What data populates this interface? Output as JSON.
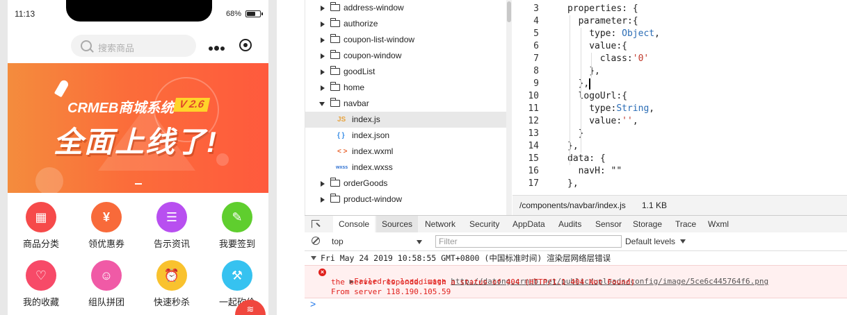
{
  "phone": {
    "time": "11:13",
    "battery_pct": "68%",
    "battery_level": 0.68,
    "search_placeholder": "搜索商品",
    "banner": {
      "brand": "CRMEB商城系统",
      "version": "V 2.6",
      "slogan": "全面上线了!"
    },
    "grid": [
      {
        "label": "商品分类",
        "icon": "category-icon",
        "color": "#f64a4a",
        "glyph": "▦"
      },
      {
        "label": "领优惠券",
        "icon": "coupon-icon",
        "color": "#f86a3a",
        "glyph": "¥"
      },
      {
        "label": "告示资讯",
        "icon": "news-icon",
        "color": "#b84ff0",
        "glyph": "☰"
      },
      {
        "label": "我要签到",
        "icon": "sign-in-icon",
        "color": "#5fce2e",
        "glyph": "✎"
      },
      {
        "label": "我的收藏",
        "icon": "favorite-icon",
        "color": "#f74a68",
        "glyph": "♡"
      },
      {
        "label": "组队拼团",
        "icon": "group-buy-icon",
        "color": "#f05aa6",
        "glyph": "☺"
      },
      {
        "label": "快速秒杀",
        "icon": "flash-sale-icon",
        "color": "#f9c22e",
        "glyph": "⏰"
      },
      {
        "label": "一起砍价",
        "icon": "bargain-icon",
        "color": "#36c2f0",
        "glyph": "⚒"
      }
    ]
  },
  "file_tree": [
    {
      "name": "address-window",
      "type": "folder",
      "expanded": false
    },
    {
      "name": "authorize",
      "type": "folder",
      "expanded": false
    },
    {
      "name": "coupon-list-window",
      "type": "folder",
      "expanded": false
    },
    {
      "name": "coupon-window",
      "type": "folder",
      "expanded": false
    },
    {
      "name": "goodList",
      "type": "folder",
      "expanded": false
    },
    {
      "name": "home",
      "type": "folder",
      "expanded": false
    },
    {
      "name": "navbar",
      "type": "folder",
      "expanded": true
    },
    {
      "name": "index.js",
      "type": "js",
      "icon_text": "JS",
      "selected": true
    },
    {
      "name": "index.json",
      "type": "json",
      "icon_text": "{ }"
    },
    {
      "name": "index.wxml",
      "type": "wxml",
      "icon_text": "< >"
    },
    {
      "name": "index.wxss",
      "type": "wxss",
      "icon_text": "wxss"
    },
    {
      "name": "orderGoods",
      "type": "folder",
      "expanded": false
    },
    {
      "name": "product-window",
      "type": "folder",
      "expanded": false
    }
  ],
  "editor": {
    "lines": [
      {
        "n": "3",
        "indent": 0,
        "text": "properties: {"
      },
      {
        "n": "4",
        "indent": 1,
        "text": "parameter:{"
      },
      {
        "n": "5",
        "indent": 2,
        "text": "type: ",
        "type": "Object",
        "tail": ","
      },
      {
        "n": "6",
        "indent": 2,
        "text": "value:{"
      },
      {
        "n": "7",
        "indent": 3,
        "text": "class:",
        "str": "'0'"
      },
      {
        "n": "8",
        "indent": 2,
        "text": "},"
      },
      {
        "n": "9",
        "indent": 1,
        "text": "},"
      },
      {
        "n": "10",
        "indent": 1,
        "text": "logoUrl:{"
      },
      {
        "n": "11",
        "indent": 2,
        "text": "type:",
        "type": "String",
        "tail": ","
      },
      {
        "n": "12",
        "indent": 2,
        "text": "value:",
        "str": "''",
        "tail": ","
      },
      {
        "n": "13",
        "indent": 1,
        "text": "}"
      },
      {
        "n": "14",
        "indent": 0,
        "text": "},"
      },
      {
        "n": "15",
        "indent": 0,
        "text": "data: {"
      },
      {
        "n": "16",
        "indent": 1,
        "text": "navH: \"\""
      },
      {
        "n": "17",
        "indent": 0,
        "text": "},"
      }
    ],
    "file_path": "/components/navbar/index.js",
    "file_size": "1.1 KB"
  },
  "devtools": {
    "tabs": [
      "Console",
      "Sources",
      "Network",
      "Security",
      "AppData",
      "Audits",
      "Sensor",
      "Storage",
      "Trace",
      "Wxml"
    ],
    "active_tab": "Console",
    "context": "top",
    "filter_placeholder": "Filter",
    "levels_label": "Default levels",
    "group_title": "Fri May 24 2019 10:58:55 GMT+0800 (中国标准时间) 渲染层网络层错误",
    "error": {
      "prefix": "Failed to load image ",
      "url": "http://datong.crmeb.net/public/uploads/config/image/5ce6c445764f6.png",
      "line2": "the server responded with a status of 404 (HTTP/1.1 404 Not Found)",
      "line3": "From server 118.190.105.59"
    },
    "prompt": ">"
  },
  "colors": {
    "banner_start": "#f48c3d",
    "banner_end": "#ff5a3d",
    "error_text": "#e0201c",
    "error_bg": "#fff0f0",
    "string": "#c0392b",
    "type": "#2a6cb5"
  }
}
